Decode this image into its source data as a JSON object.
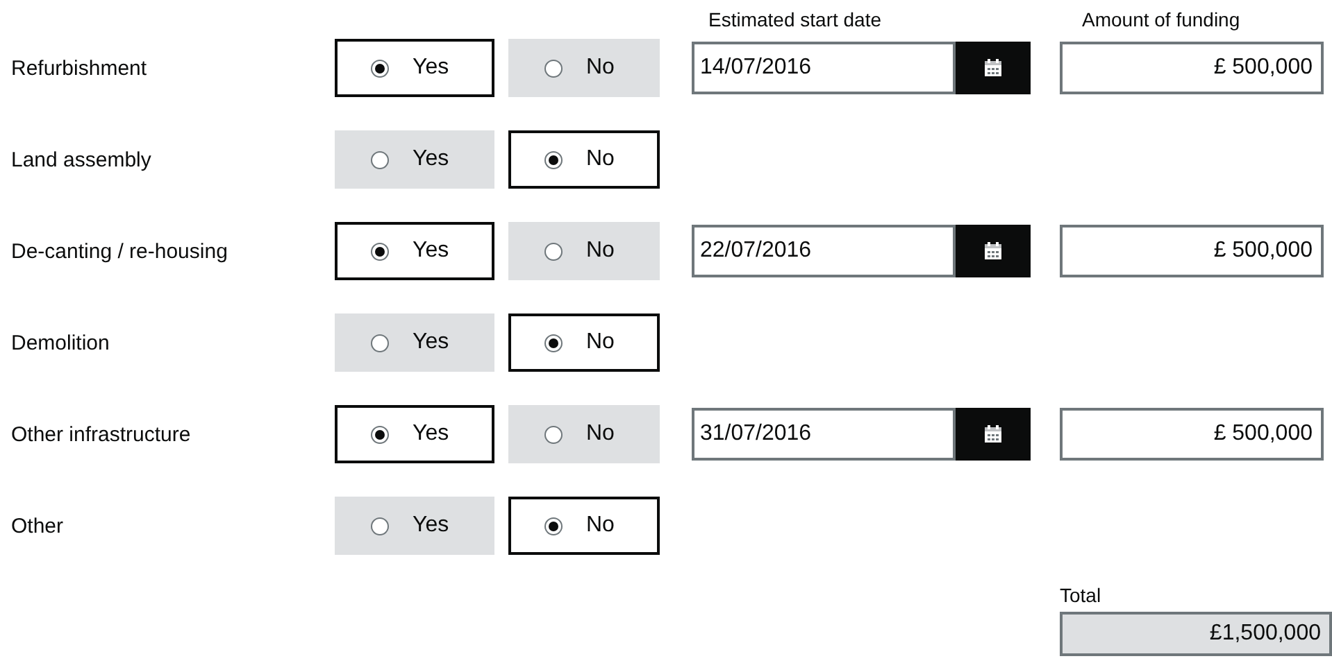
{
  "headers": {
    "start_date": "Estimated start date",
    "funding": "Amount of funding"
  },
  "rows": [
    {
      "label": "Refurbishment",
      "options": [
        {
          "label": "Yes",
          "selected": true
        },
        {
          "label": "No",
          "selected": false
        }
      ],
      "start_date": "14/07/2016",
      "funding": "£ 500,000"
    },
    {
      "label": "Land assembly",
      "options": [
        {
          "label": "Yes",
          "selected": false
        },
        {
          "label": "No",
          "selected": true
        }
      ]
    },
    {
      "label": "De-canting / re-housing",
      "options": [
        {
          "label": "Yes",
          "selected": true
        },
        {
          "label": "No",
          "selected": false
        }
      ],
      "start_date": "22/07/2016",
      "funding": "£ 500,000"
    },
    {
      "label": "Demolition",
      "options": [
        {
          "label": "Yes",
          "selected": false
        },
        {
          "label": "No",
          "selected": true
        }
      ]
    },
    {
      "label": "Other infrastructure",
      "options": [
        {
          "label": "Yes",
          "selected": true
        },
        {
          "label": "No",
          "selected": false
        }
      ],
      "start_date": "31/07/2016",
      "funding": "£ 500,000"
    },
    {
      "label": "Other",
      "options": [
        {
          "label": "Yes",
          "selected": false
        },
        {
          "label": "No",
          "selected": true
        }
      ]
    }
  ],
  "total": {
    "label": "Total",
    "value": "£1,500,000"
  }
}
